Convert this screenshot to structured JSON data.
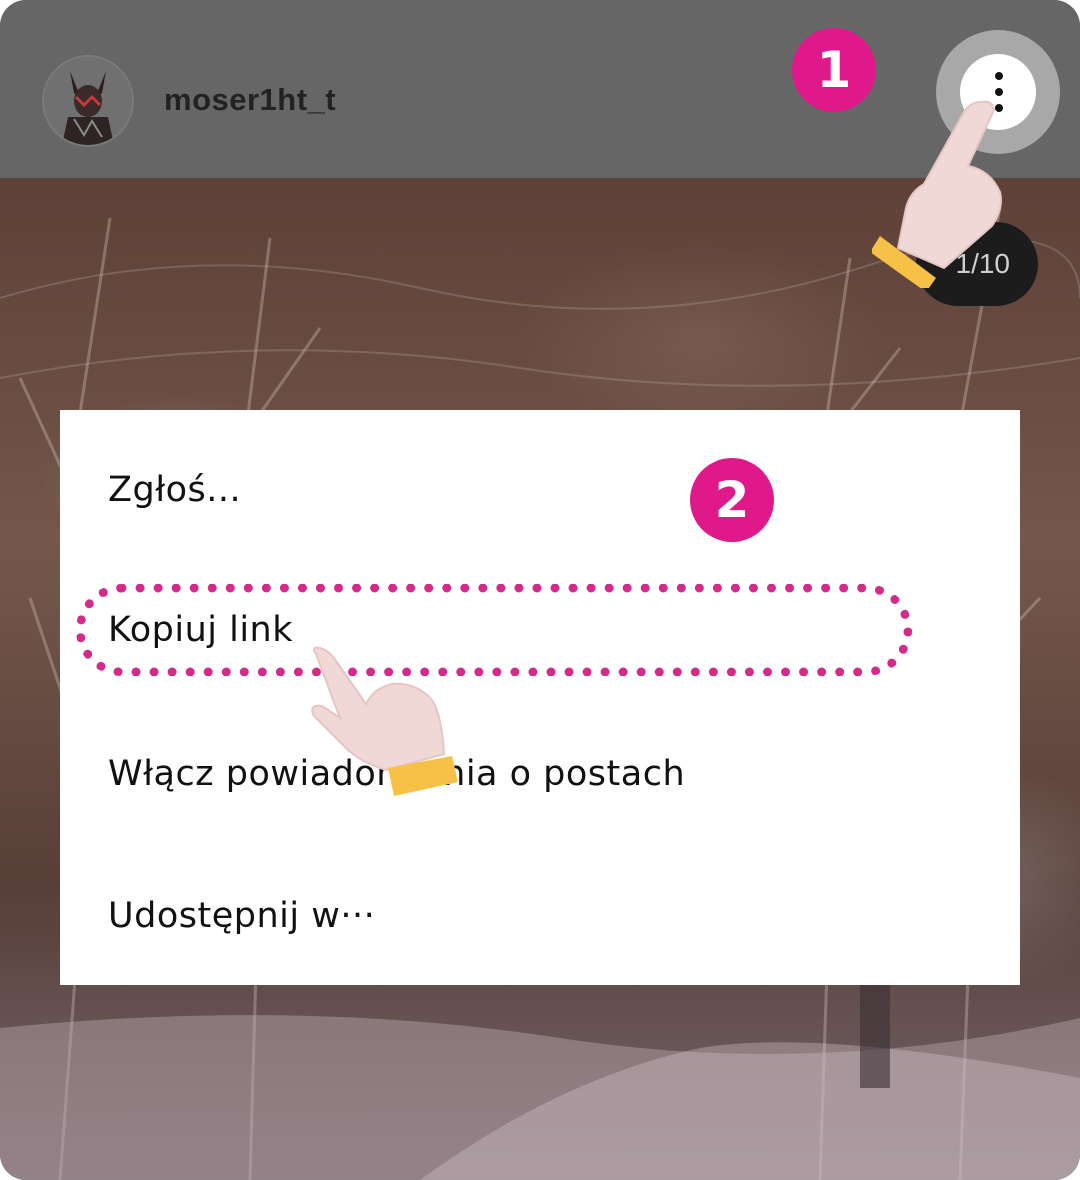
{
  "post": {
    "username": "moser1ht_t",
    "image_counter": "1/10"
  },
  "menu": {
    "items": [
      {
        "label": "Zgłoś..."
      },
      {
        "label": "Kopiuj link"
      },
      {
        "label": "Włącz powiadomienia o postach"
      },
      {
        "label": "Udostępnij w···"
      }
    ]
  },
  "annotations": {
    "step1": "1",
    "step2": "2",
    "step_color": "#e0198a",
    "highlight_color": "#d42a8a"
  },
  "icons": {
    "more": "more-vertical-icon",
    "pointer": "pointing-hand-icon"
  }
}
